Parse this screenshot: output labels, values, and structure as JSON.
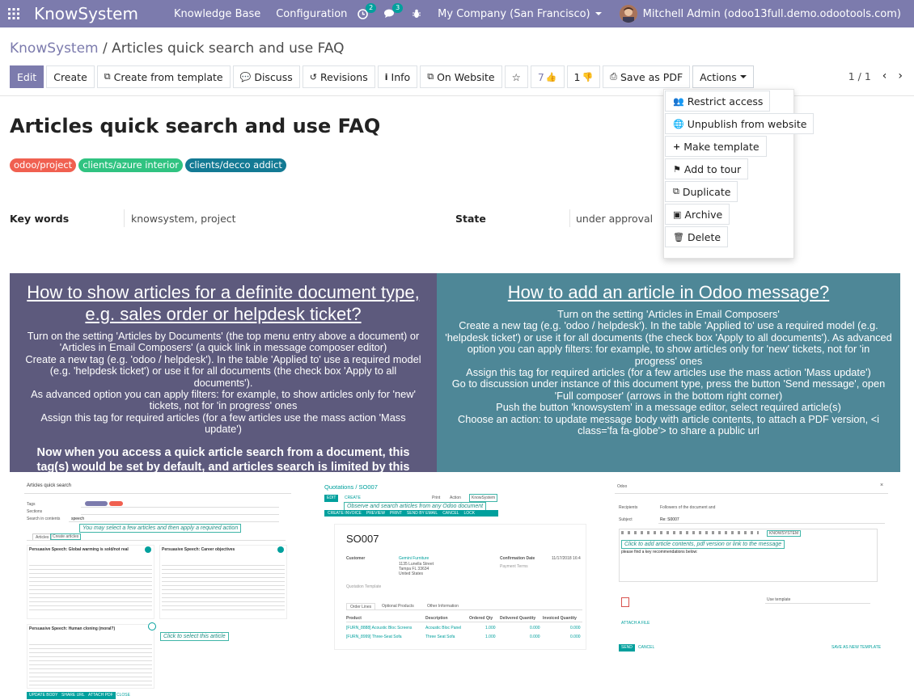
{
  "navbar": {
    "brand": "KnowSystem",
    "menu": [
      "Knowledge Base",
      "Configuration"
    ],
    "activity_count": "2",
    "messages_count": "3",
    "company": "My Company (San Francisco)",
    "user": "Mitchell Admin (odoo13full.demo.odootools.com)"
  },
  "breadcrumb": {
    "parent": "KnowSystem",
    "separator": "/",
    "current": "Articles quick search and use FAQ"
  },
  "buttons": {
    "edit": "Edit",
    "create": "Create",
    "create_template": "Create from template",
    "discuss": "Discuss",
    "revisions": "Revisions",
    "info": "Info",
    "website": "On Website",
    "likes": "7",
    "dislikes": "1",
    "pdf": "Save as PDF",
    "actions": "Actions"
  },
  "pager": "1 / 1",
  "actions_menu": [
    "Restrict access",
    "Unpublish from website",
    "Make template",
    "Add to tour",
    "Duplicate",
    "Archive",
    "Delete"
  ],
  "article": {
    "title": "Articles quick search and use FAQ",
    "tags": [
      {
        "label": "odoo/project",
        "color": "#f06050"
      },
      {
        "label": "clients/azure interior",
        "color": "#30c381"
      },
      {
        "label": "clients/decco addict",
        "color": "#137a94"
      }
    ],
    "keywords_label": "Key words",
    "keywords_value": "knowsystem, project",
    "state_label": "State",
    "state_value": "under approval"
  },
  "panels": {
    "left": {
      "heading": "How to show articles for a definite document type, e.g. sales order or helpdesk ticket?",
      "lines": [
        "Turn on the setting 'Articles by Documents' (the top menu entry above a document) or 'Articles in Email Composers' (a quick link in message composer editor)",
        "Create a new tag (e.g. 'odoo / helpdesk'). In the table 'Applied to' use a required model (e.g. 'helpdesk ticket') or use it for all documents (the check box 'Apply to all documents').",
        "As advanced option you can apply filters: for example, to show articles only for 'new' tickets, not for 'in progress' ones",
        "Assign this tag for required articles (for a few articles use the mass action 'Mass update')"
      ],
      "bold": "Now when you access a quick article search from a document, this tag(s) would be set by default, and articles search is limited by this document type / domain"
    },
    "right": {
      "heading": "How to add an article in Odoo message?",
      "lines": [
        "Turn on the setting 'Articles in Email Composers'",
        "Create a new tag (e.g. 'odoo / helpdesk'). In the table 'Applied to' use a required model (e.g. 'helpdesk ticket') or use it for all documents (the check box 'Apply to all documents'). As advanced option you can apply filters: for example, to show articles only for 'new' tickets, not for 'in progress' ones",
        "Assign this tag for required articles (for a few articles use the mass action 'Mass update')",
        "Go to discussion under instance of this document type, press the button 'Send message', open 'Full composer' (arrows in the bottom right corner)",
        "Push the button 'knowsystem' in a message editor, select required article(s)",
        "Choose an action: to update message body with article contents, to attach a PDF version, <i class='fa fa-globe'> to share a public url"
      ]
    }
  },
  "screenshots": {
    "s1": {
      "title": "Articles quick search",
      "tags_label": "Tags",
      "sections_label": "Sections",
      "search_label": "Search in contents",
      "search_value": "speech",
      "tab_articles": "Articles",
      "tab_create": "Create articles",
      "note1": "You may select a few articles and then apply a required action",
      "card1_title": "Persuasive Speech: Global warming is sold/not real",
      "card2_title": "Persuasive Speech: Career objectives",
      "card3_title": "Persuasive Speech: Human cloning (moral?)",
      "note2": "Click to select this article",
      "btn1": "UPDATE BODY",
      "btn2": "SHARE URL",
      "btn3": "ATTACH PDF",
      "btn4": "CLOSE"
    },
    "s2": {
      "crumb": "Quotations / SO007",
      "btn_edit": "EDIT",
      "btn_create": "CREATE",
      "note": "Observe and search articles from any Odoo document",
      "knowsystem": "KnowSystem",
      "print": "Print",
      "action": "Action",
      "order": "SO007",
      "customer_label": "Customer",
      "customer": "Gemini Furniture",
      "address1": "1135 Lunella Street",
      "address2": "Tampa FL 33634",
      "address3": "United States",
      "confirm_label": "Confirmation Date",
      "confirm_value": "11/17/2018 16:4",
      "payment_label": "Payment Terms",
      "template_label": "Quotation Template",
      "tab1": "Order Lines",
      "tab2": "Optional Products",
      "tab3": "Other Information",
      "cols": [
        "Product",
        "Description",
        "Ordered Qty",
        "Delivered Quantity",
        "Invoiced Quantity"
      ],
      "rows": [
        [
          "[FURN_8888] Acoustic Bloc Screens",
          "Acoustic Bloc Panel",
          "1.000",
          "0.000",
          "0.000"
        ],
        [
          "[FURN_8999] Three-Seat Sofa",
          "Three Seat Sofa",
          "1.000",
          "0.000",
          "0.000"
        ]
      ],
      "toolbar": [
        "CREATE INVOICE",
        "PREVIEW",
        "PRINT",
        "SEND BY EMAIL",
        "CANCEL",
        "LOCK"
      ]
    },
    "s3": {
      "title": "Odoo",
      "recipients_label": "Recipients",
      "recipients_value": "Followers of the document and",
      "subject_label": "Subject",
      "subject_value": "Re: S0007",
      "knowsystem": "KNOWSYSTEM",
      "note": "Click to add article contents, pdf version or link to the message",
      "body": "please find a key recommendations below:",
      "use_template": "Use template",
      "attach": "ATTACH A FILE",
      "send": "SEND",
      "cancel": "CANCEL",
      "save_template": "SAVE AS NEW TEMPLATE"
    }
  }
}
